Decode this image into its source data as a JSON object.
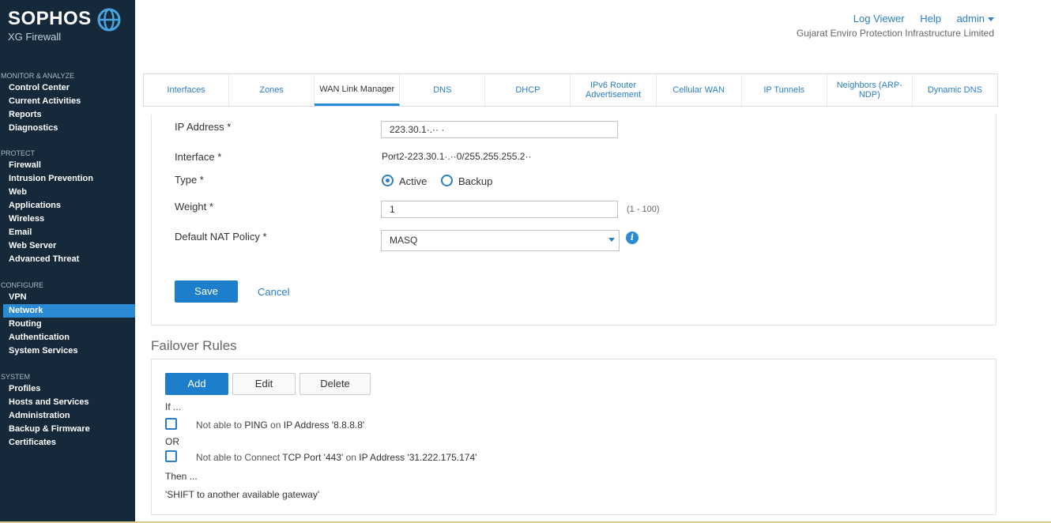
{
  "brand": {
    "name": "SOPHOS",
    "product": "XG Firewall"
  },
  "sidebar": {
    "sections": [
      {
        "heading": "MONITOR & ANALYZE",
        "items": [
          "Control Center",
          "Current Activities",
          "Reports",
          "Diagnostics"
        ]
      },
      {
        "heading": "PROTECT",
        "items": [
          "Firewall",
          "Intrusion Prevention",
          "Web",
          "Applications",
          "Wireless",
          "Email",
          "Web Server",
          "Advanced Threat"
        ]
      },
      {
        "heading": "CONFIGURE",
        "items": [
          "VPN",
          "Network",
          "Routing",
          "Authentication",
          "System Services"
        ]
      },
      {
        "heading": "SYSTEM",
        "items": [
          "Profiles",
          "Hosts and Services",
          "Administration",
          "Backup & Firmware",
          "Certificates"
        ]
      }
    ],
    "active_item": "Network"
  },
  "header": {
    "log_viewer": "Log Viewer",
    "help": "Help",
    "user": "admin",
    "company": "Gujarat Enviro Protection Infrastructure Limited"
  },
  "tabs": [
    "Interfaces",
    "Zones",
    "WAN Link Manager",
    "DNS",
    "DHCP",
    "IPv6 Router Advertisement",
    "Cellular WAN",
    "IP Tunnels",
    "Neighbors (ARP-NDP)",
    "Dynamic DNS"
  ],
  "active_tab": "WAN Link Manager",
  "form": {
    "ip_label": "IP Address *",
    "ip_value": "223.30.1·.·· ·",
    "interface_label": "Interface *",
    "interface_value": "Port2-223.30.1·.··0/255.255.255.2··",
    "type_label": "Type *",
    "type_active": "Active",
    "type_backup": "Backup",
    "type_selected": "Active",
    "weight_label": "Weight *",
    "weight_value": "1",
    "weight_hint": "(1 - 100)",
    "nat_label": "Default NAT Policy *",
    "nat_value": "MASQ",
    "save": "Save",
    "cancel": "Cancel"
  },
  "failover": {
    "title": "Failover Rules",
    "add": "Add",
    "edit": "Edit",
    "delete": "Delete",
    "if": "If ...",
    "or": "OR",
    "then": "Then ...",
    "rule1": {
      "pre": "Not able to ",
      "proto": "PING",
      "mid": " on ",
      "target": "IP Address '8.8.8.8'"
    },
    "rule2": {
      "pre": "Not able to Connect ",
      "proto": "TCP Port '443'",
      "mid": " on ",
      "target": "IP Address '31.222.175.174'"
    },
    "action": "'SHIFT to another available gateway'"
  },
  "colors": {
    "sidebar_bg": "#15293a",
    "accent": "#1d7fcc",
    "link": "#2a7ec7"
  }
}
